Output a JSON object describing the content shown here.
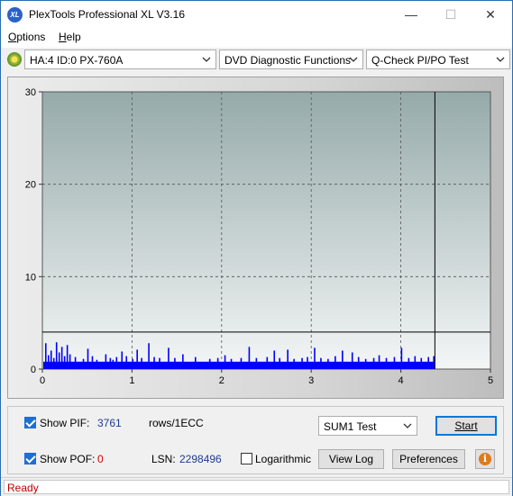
{
  "window": {
    "title": "PlexTools Professional XL V3.16",
    "icon_label": "XL",
    "controls": {
      "minimize": "—",
      "maximize": "☐",
      "close": "✕"
    }
  },
  "menu": {
    "options_first": "O",
    "options_rest": "ptions",
    "help_first": "H",
    "help_rest": "elp"
  },
  "toolbar": {
    "drive": "HA:4 ID:0  PX-760A",
    "function": "DVD Diagnostic Functions",
    "test": "Q-Check PI/PO Test"
  },
  "chart_data": {
    "type": "bar",
    "xlim": [
      0,
      5
    ],
    "ylim": [
      0,
      30
    ],
    "x_ticks": [
      "0",
      "1",
      "2",
      "3",
      "4",
      "5"
    ],
    "y_ticks": [
      "0",
      "10",
      "20",
      "30"
    ],
    "grid": true,
    "threshold": 4,
    "end_marker_x": 4.38,
    "series": [
      {
        "color": "#0000ff",
        "baseline": 0.8,
        "spikes": [
          [
            0.03,
            2.8
          ],
          [
            0.06,
            1.5
          ],
          [
            0.09,
            2.0
          ],
          [
            0.12,
            1.2
          ],
          [
            0.15,
            2.9
          ],
          [
            0.18,
            1.8
          ],
          [
            0.21,
            2.4
          ],
          [
            0.24,
            1.4
          ],
          [
            0.27,
            2.6
          ],
          [
            0.3,
            1.6
          ],
          [
            0.36,
            1.3
          ],
          [
            0.45,
            1.1
          ],
          [
            0.5,
            2.2
          ],
          [
            0.55,
            1.4
          ],
          [
            0.6,
            1.0
          ],
          [
            0.7,
            1.6
          ],
          [
            0.75,
            1.2
          ],
          [
            0.78,
            1.0
          ],
          [
            0.82,
            1.3
          ],
          [
            0.88,
            1.9
          ],
          [
            0.93,
            1.4
          ],
          [
            1.0,
            1.1
          ],
          [
            1.05,
            2.1
          ],
          [
            1.1,
            1.2
          ],
          [
            1.18,
            2.8
          ],
          [
            1.24,
            1.3
          ],
          [
            1.3,
            1.2
          ],
          [
            1.4,
            2.3
          ],
          [
            1.47,
            1.2
          ],
          [
            1.56,
            1.6
          ],
          [
            1.7,
            1.3
          ],
          [
            1.86,
            1.1
          ],
          [
            1.95,
            1.2
          ],
          [
            2.03,
            1.5
          ],
          [
            2.1,
            1.1
          ],
          [
            2.21,
            1.2
          ],
          [
            2.3,
            2.4
          ],
          [
            2.38,
            1.2
          ],
          [
            2.5,
            1.3
          ],
          [
            2.58,
            2.0
          ],
          [
            2.64,
            1.2
          ],
          [
            2.73,
            2.1
          ],
          [
            2.8,
            1.1
          ],
          [
            2.89,
            1.2
          ],
          [
            2.95,
            1.3
          ],
          [
            3.03,
            2.3
          ],
          [
            3.1,
            1.2
          ],
          [
            3.18,
            1.1
          ],
          [
            3.26,
            1.4
          ],
          [
            3.34,
            2.0
          ],
          [
            3.45,
            1.8
          ],
          [
            3.52,
            1.3
          ],
          [
            3.6,
            1.1
          ],
          [
            3.69,
            1.2
          ],
          [
            3.75,
            1.5
          ],
          [
            3.83,
            1.2
          ],
          [
            3.92,
            1.3
          ],
          [
            4.0,
            2.3
          ],
          [
            4.08,
            1.2
          ],
          [
            4.15,
            1.4
          ],
          [
            4.22,
            1.2
          ],
          [
            4.3,
            1.3
          ],
          [
            4.36,
            1.4
          ]
        ]
      }
    ]
  },
  "controls": {
    "show_pif_label": "Show PIF:",
    "pif_value": "3761",
    "pif_unit": "rows/1ECC",
    "show_pof_label": "Show POF:",
    "pof_value": "0",
    "lsn_label": "LSN:",
    "lsn_value": "2298496",
    "logarithmic_label": "Logarithmic",
    "sum_select": "SUM1 Test",
    "start_label": "Start",
    "view_log_label": "View Log",
    "preferences_label": "Preferences",
    "info_glyph": "i"
  },
  "status": {
    "text": "Ready"
  }
}
